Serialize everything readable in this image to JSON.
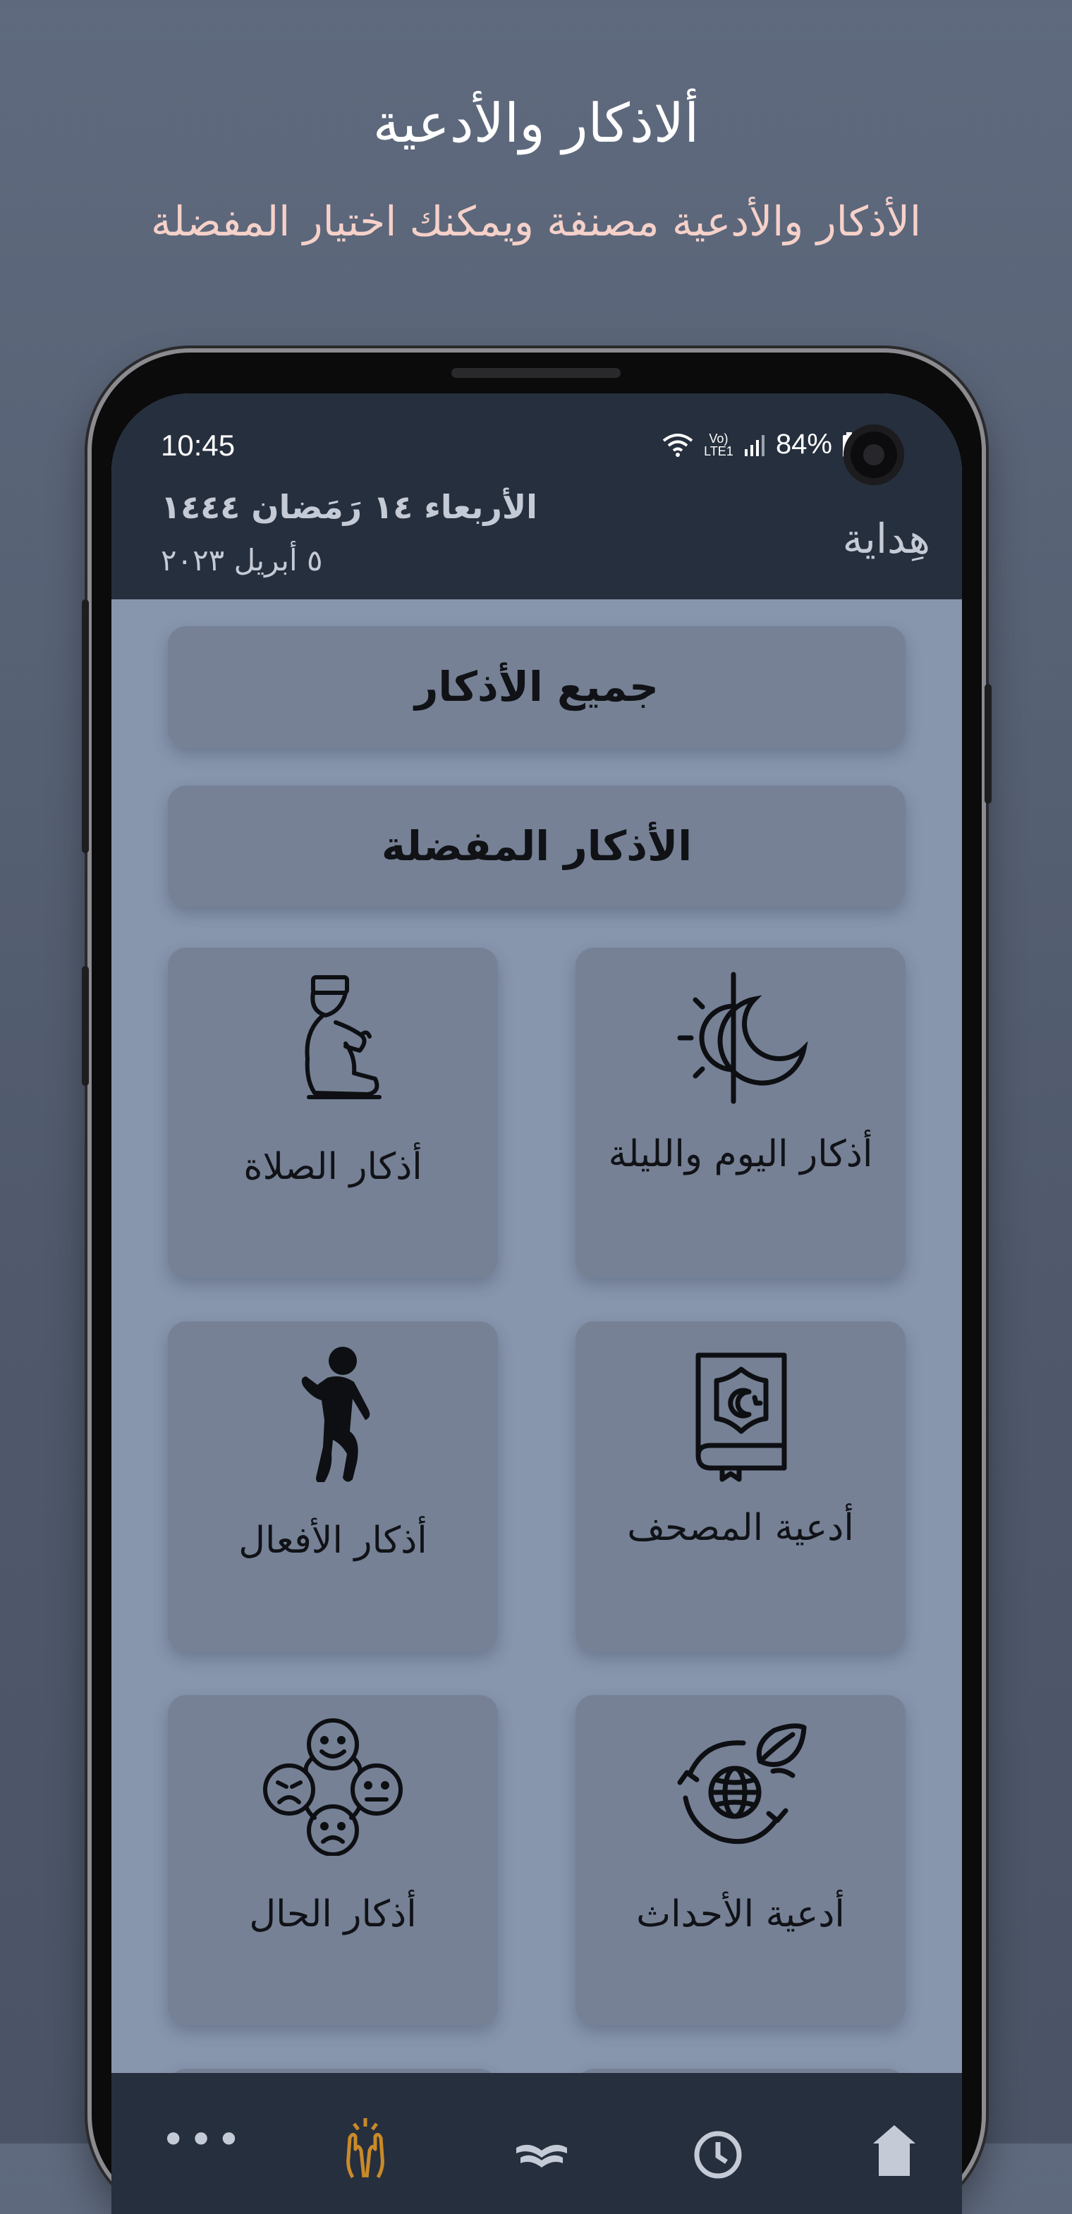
{
  "promo": {
    "title": "ألاذكار والأدعية",
    "subtitle": "الأذكار والأدعية مصنفة ويمكنك اختيار المفضلة"
  },
  "status_bar": {
    "time": "10:45",
    "network": "Vo) LTE1",
    "battery": "84%"
  },
  "header": {
    "hijri_date": "الأربعاء ١٤ رَمَضان ١٤٤٤",
    "gregorian_date": "٥ أبريل ٢٠٢٣",
    "app_name": "هِداية"
  },
  "main": {
    "all_azkar": "جميع الأذكار",
    "favorites": "الأذكار المفضلة",
    "tiles": [
      {
        "label": "أذكار اليوم والليلة",
        "icon": "day-night-icon"
      },
      {
        "label": "أذكار الصلاة",
        "icon": "praying-person-icon"
      },
      {
        "label": "أدعية المصحف",
        "icon": "quran-book-icon"
      },
      {
        "label": "أذكار الأفعال",
        "icon": "walking-person-icon"
      },
      {
        "label": "أدعية الأحداث",
        "icon": "globe-cycle-icon"
      },
      {
        "label": "أذكار الحال",
        "icon": "emotions-icon"
      }
    ]
  },
  "bottom_nav": {
    "items": [
      "home-icon",
      "clock-icon",
      "open-book-icon",
      "praying-hands-icon",
      "more-icon"
    ],
    "more_label": "•••",
    "active_item": "praying-hands-icon",
    "active_color": "#c98a2a"
  },
  "colors": {
    "background": "#56607a",
    "topbar": "#262f3d",
    "card": "#768196",
    "screen": "#8795ad",
    "subtitle": "#f6d1c9"
  }
}
